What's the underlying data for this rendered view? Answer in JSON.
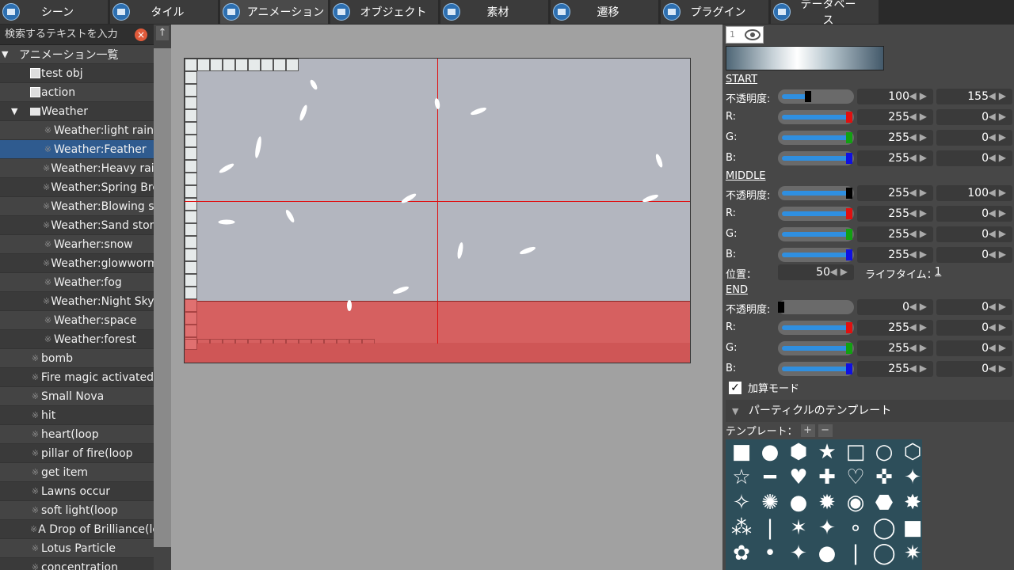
{
  "tabs": [
    {
      "label": "シーン",
      "icon": "scene-icon"
    },
    {
      "label": "タイル",
      "icon": "tile-icon"
    },
    {
      "label": "アニメーション",
      "icon": "animation-icon",
      "active": true
    },
    {
      "label": "オブジェクト",
      "icon": "object-icon"
    },
    {
      "label": "素材",
      "icon": "material-icon"
    },
    {
      "label": "遷移",
      "icon": "transition-icon"
    },
    {
      "label": "プラグイン",
      "icon": "plugin-icon"
    },
    {
      "label": "データベース",
      "icon": "database-icon"
    }
  ],
  "search": {
    "placeholder": "検索するテキストを入力"
  },
  "tree": {
    "root": "アニメーション一覧",
    "items": [
      {
        "label": "test obj",
        "indent": 2,
        "type": "obj"
      },
      {
        "label": "action",
        "indent": 2,
        "type": "obj"
      },
      {
        "label": "Weather",
        "indent": 1,
        "type": "folder"
      },
      {
        "label": "Weather:light rain",
        "indent": 3,
        "type": "anim"
      },
      {
        "label": "Weather:Feather",
        "indent": 3,
        "type": "anim",
        "selected": true
      },
      {
        "label": "Weather:Heavy rain",
        "indent": 3,
        "type": "anim"
      },
      {
        "label": "Weather:Spring Bre",
        "indent": 3,
        "type": "anim"
      },
      {
        "label": "Weather:Blowing sn",
        "indent": 3,
        "type": "anim"
      },
      {
        "label": "Weather:Sand storm",
        "indent": 3,
        "type": "anim"
      },
      {
        "label": "Wearher:snow",
        "indent": 3,
        "type": "anim"
      },
      {
        "label": "Weather:glowworm",
        "indent": 3,
        "type": "anim"
      },
      {
        "label": "Weather:fog",
        "indent": 3,
        "type": "anim"
      },
      {
        "label": "Weather:Night Sky",
        "indent": 3,
        "type": "anim"
      },
      {
        "label": "Weather:space",
        "indent": 3,
        "type": "anim"
      },
      {
        "label": "Weather:forest",
        "indent": 3,
        "type": "anim"
      },
      {
        "label": "bomb",
        "indent": 2,
        "type": "anim"
      },
      {
        "label": "Fire magic activated",
        "indent": 2,
        "type": "anim"
      },
      {
        "label": "Small Nova",
        "indent": 2,
        "type": "anim"
      },
      {
        "label": "hit",
        "indent": 2,
        "type": "anim"
      },
      {
        "label": "heart(loop",
        "indent": 2,
        "type": "anim"
      },
      {
        "label": "pillar of fire(loop",
        "indent": 2,
        "type": "anim"
      },
      {
        "label": "get item",
        "indent": 2,
        "type": "anim"
      },
      {
        "label": "Lawns occur",
        "indent": 2,
        "type": "anim"
      },
      {
        "label": "soft light(loop",
        "indent": 2,
        "type": "anim"
      },
      {
        "label": "A Drop of Brilliance(lo",
        "indent": 2,
        "type": "anim"
      },
      {
        "label": "Lotus Particle",
        "indent": 2,
        "type": "anim"
      },
      {
        "label": "concentration",
        "indent": 2,
        "type": "anim"
      }
    ]
  },
  "layer": {
    "number": "1"
  },
  "sections": {
    "start": "START",
    "middle": "MIDDLE",
    "end": "END"
  },
  "labels": {
    "opacity": "不透明度:",
    "r": "R:",
    "g": "G:",
    "b": "B:",
    "position": "位置：",
    "lifetime": "ライフタイム：",
    "additive": "加算モード",
    "template_header": "パーティクルのテンプレート",
    "template_label": "テンプレート："
  },
  "start": {
    "opacity": {
      "a": "100",
      "b": "155",
      "level": 0.39
    },
    "r": {
      "a": "255",
      "b": "0",
      "level": 1.0
    },
    "g": {
      "a": "255",
      "b": "0",
      "level": 1.0
    },
    "b": {
      "a": "255",
      "b": "0",
      "level": 1.0
    }
  },
  "middle": {
    "opacity": {
      "a": "255",
      "b": "100",
      "level": 1.0
    },
    "r": {
      "a": "255",
      "b": "0",
      "level": 1.0
    },
    "g": {
      "a": "255",
      "b": "0",
      "level": 1.0
    },
    "b": {
      "a": "255",
      "b": "0",
      "level": 1.0
    }
  },
  "position": {
    "value": "50",
    "lifetime": "1"
  },
  "end": {
    "opacity": {
      "a": "0",
      "b": "0",
      "level": 0.0
    },
    "r": {
      "a": "255",
      "b": "0",
      "level": 1.0
    },
    "g": {
      "a": "255",
      "b": "0",
      "level": 1.0
    },
    "b": {
      "a": "255",
      "b": "0",
      "level": 1.0
    }
  },
  "additive_checked": true,
  "templates": [
    "■",
    "●",
    "⬢",
    "★",
    "□",
    "○",
    "⬡",
    "☆",
    "━",
    "♥",
    "✚",
    "♡",
    "✜",
    "✦",
    "✧",
    "✺",
    "●",
    "✹",
    "◉",
    "⬣",
    "✸",
    "⁂",
    "|",
    "✶",
    "✦",
    "∘",
    "◯",
    "■",
    "✿",
    "•",
    "✦",
    "●",
    "|",
    "◯",
    "✷"
  ],
  "colors": {
    "accent": "#2f8fe0",
    "selected_row": "#2f5b8f",
    "guide_line": "#e01010",
    "r_knob": "#e01010",
    "g_knob": "#12a012",
    "b_knob": "#1010e0",
    "knob_black": "#000000"
  }
}
